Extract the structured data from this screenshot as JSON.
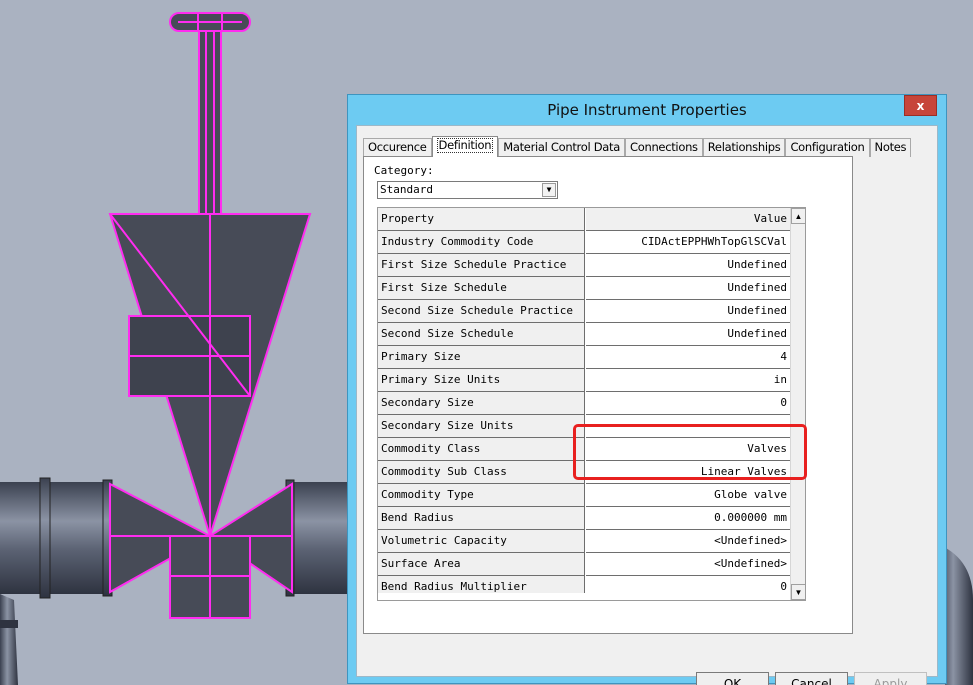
{
  "dialog": {
    "title": "Pipe Instrument Properties",
    "close_glyph": "x",
    "tabs": [
      {
        "label": "Occurence",
        "active": false
      },
      {
        "label": "Definition",
        "active": true
      },
      {
        "label": "Material Control Data",
        "active": false
      },
      {
        "label": "Connections",
        "active": false
      },
      {
        "label": "Relationships",
        "active": false
      },
      {
        "label": "Configuration",
        "active": false
      },
      {
        "label": "Notes",
        "active": false
      }
    ],
    "category": {
      "label": "Category:",
      "value": "Standard"
    },
    "grid": {
      "headers": {
        "property": "Property",
        "value": "Value"
      },
      "rows": [
        {
          "property": "Industry Commodity Code",
          "value": "CIDActEPPHWhTopGlSCVal"
        },
        {
          "property": "First Size Schedule Practice",
          "value": "Undefined"
        },
        {
          "property": "First Size Schedule",
          "value": "Undefined"
        },
        {
          "property": "Second Size Schedule Practice",
          "value": "Undefined"
        },
        {
          "property": "Second Size Schedule",
          "value": "Undefined"
        },
        {
          "property": "Primary Size",
          "value": "4"
        },
        {
          "property": "Primary Size Units",
          "value": "in"
        },
        {
          "property": "Secondary Size",
          "value": "0"
        },
        {
          "property": "Secondary Size Units",
          "value": ""
        },
        {
          "property": "Commodity Class",
          "value": "Valves"
        },
        {
          "property": "Commodity Sub Class",
          "value": "Linear Valves"
        },
        {
          "property": "Commodity Type",
          "value": "Globe valve"
        },
        {
          "property": "Bend Radius",
          "value": "0.000000 mm"
        },
        {
          "property": "Volumetric Capacity",
          "value": "<Undefined>"
        },
        {
          "property": "Surface Area",
          "value": "<Undefined>"
        },
        {
          "property": "Bend Radius Multiplier",
          "value": "0"
        }
      ]
    },
    "buttons": {
      "ok": "OK",
      "cancel": "Cancel",
      "apply": "Apply"
    }
  },
  "colors": {
    "title_bar": "#6dcbf2",
    "viewport_bg": "#aab2c1",
    "selection_outline": "#ff2cf0",
    "highlight_box": "#e8201f"
  }
}
